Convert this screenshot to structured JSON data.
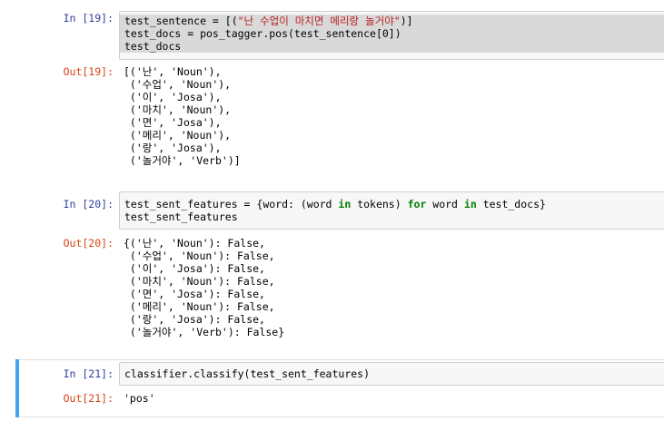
{
  "cells": [
    {
      "in_prompt": "In [19]:",
      "out_prompt": "Out[19]:",
      "code_lines": [
        [
          {
            "t": "test_sentence = [("
          },
          {
            "t": "\"난 수업이 마치면 메리랑 놀거야\"",
            "c": "str"
          },
          {
            "t": ")]"
          }
        ],
        [
          {
            "t": "test_docs = pos_tagger.pos(test_sentence[0])"
          }
        ],
        [
          {
            "t": "test_docs"
          }
        ]
      ],
      "output_lines": [
        "[('난', 'Noun'),",
        " ('수업', 'Noun'),",
        " ('이', 'Josa'),",
        " ('마치', 'Noun'),",
        " ('면', 'Josa'),",
        " ('메리', 'Noun'),",
        " ('랑', 'Josa'),",
        " ('놀거야', 'Verb')]"
      ]
    },
    {
      "in_prompt": "In [20]:",
      "out_prompt": "Out[20]:",
      "code_lines": [
        [
          {
            "t": "test_sent_features = {word: (word "
          },
          {
            "t": "in",
            "c": "kw"
          },
          {
            "t": " tokens) "
          },
          {
            "t": "for",
            "c": "kw"
          },
          {
            "t": " word "
          },
          {
            "t": "in",
            "c": "kw"
          },
          {
            "t": " test_docs}"
          }
        ],
        [
          {
            "t": "test_sent_features"
          }
        ]
      ],
      "output_lines": [
        "{('난', 'Noun'): False,",
        " ('수업', 'Noun'): False,",
        " ('이', 'Josa'): False,",
        " ('마치', 'Noun'): False,",
        " ('면', 'Josa'): False,",
        " ('메리', 'Noun'): False,",
        " ('랑', 'Josa'): False,",
        " ('놀거야', 'Verb'): False}"
      ]
    },
    {
      "in_prompt": "In [21]:",
      "out_prompt": "Out[21]:",
      "code_lines": [
        [
          {
            "t": "classifier.classify(test_sent_features)"
          }
        ]
      ],
      "output_lines": [
        "'pos'"
      ]
    }
  ]
}
